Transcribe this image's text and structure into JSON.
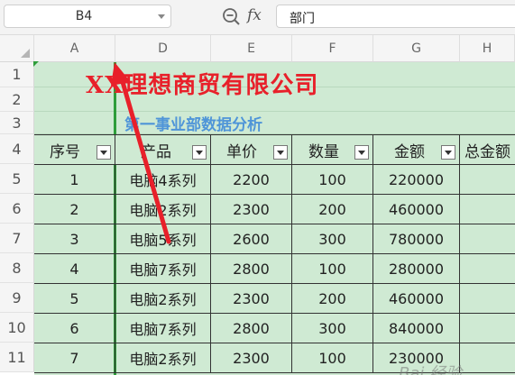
{
  "formula_bar": {
    "name_box": "B4",
    "fx_label": "fx",
    "formula_value": "部门"
  },
  "columns": [
    "A",
    "D",
    "E",
    "F",
    "G",
    "H"
  ],
  "rows": [
    "1",
    "2",
    "3",
    "4",
    "5",
    "6",
    "7",
    "8",
    "9",
    "10",
    "11"
  ],
  "sheet": {
    "title": "XX理想商贸有限公司",
    "subtitle": "第一事业部数据分析",
    "headers": [
      "序号",
      "产品",
      "单价",
      "数量",
      "金额",
      "总金额"
    ],
    "data_rows": [
      [
        "1",
        "电脑4系列",
        "2200",
        "100",
        "220000",
        ""
      ],
      [
        "2",
        "电脑2系列",
        "2300",
        "200",
        "460000",
        ""
      ],
      [
        "3",
        "电脑5系列",
        "2600",
        "300",
        "780000",
        ""
      ],
      [
        "4",
        "电脑7系列",
        "2800",
        "100",
        "280000",
        ""
      ],
      [
        "5",
        "电脑2系列",
        "2300",
        "200",
        "460000",
        ""
      ],
      [
        "6",
        "电脑7系列",
        "2800",
        "300",
        "840000",
        ""
      ],
      [
        "7",
        "电脑2系列",
        "2300",
        "100",
        "230000",
        ""
      ]
    ]
  },
  "watermark": "Bai 经验",
  "colors": {
    "title": "#e8202a",
    "subtitle": "#4f95d8",
    "cell_fill": "#cfead3",
    "annotation_arrow": "#e8202a"
  }
}
